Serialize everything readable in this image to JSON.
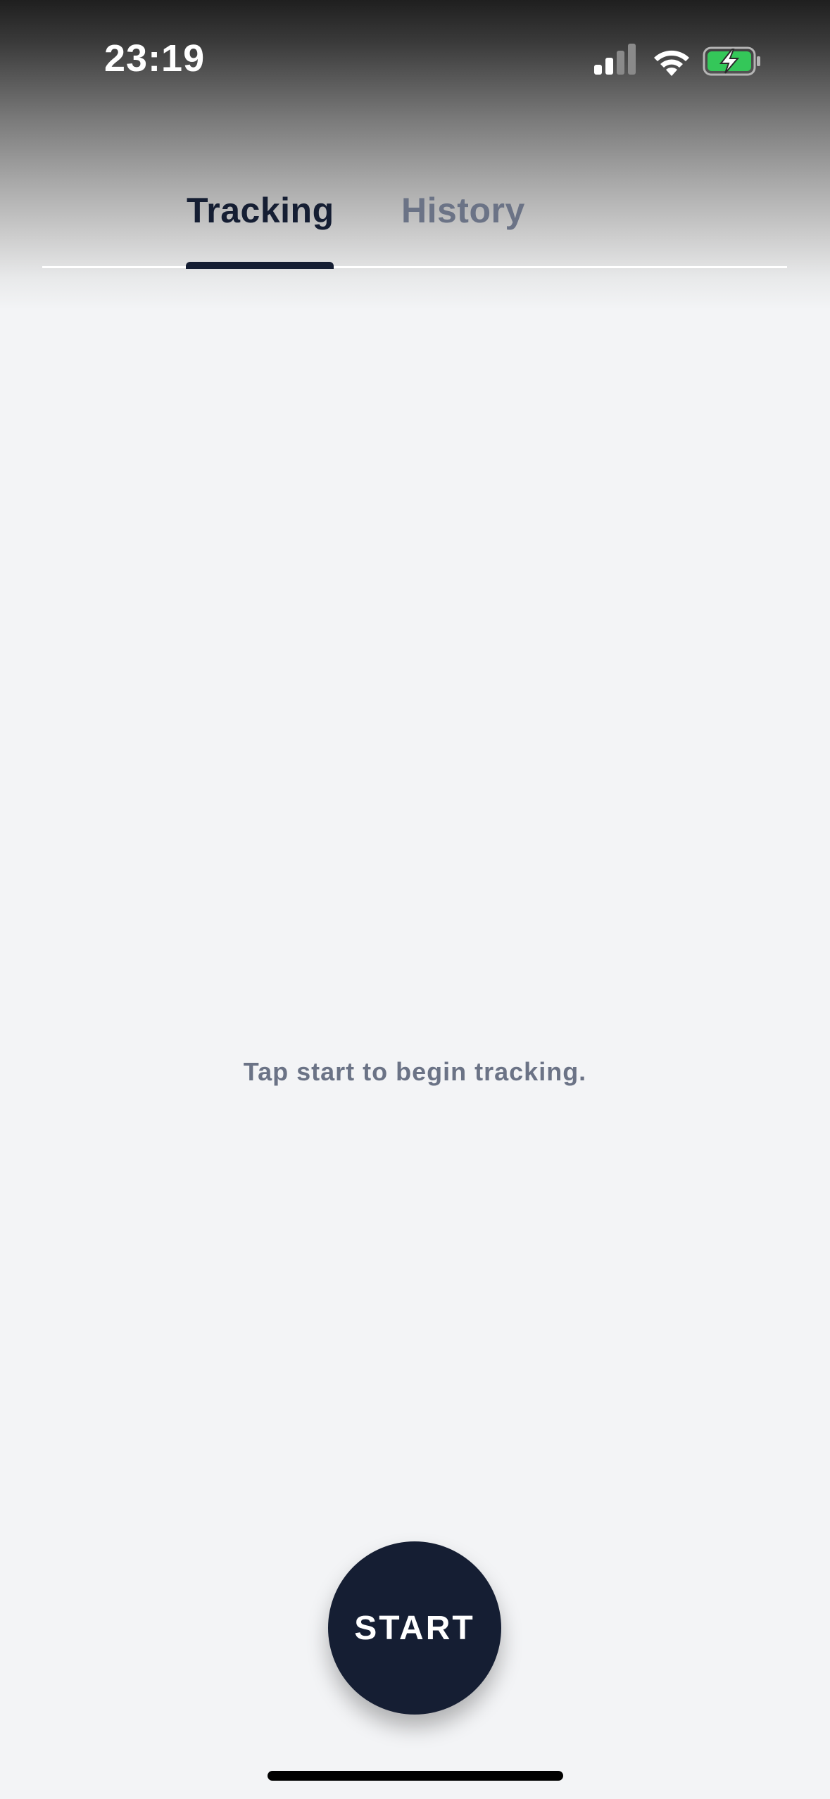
{
  "status_bar": {
    "time": "23:19",
    "icons": [
      "signal-icon",
      "wifi-icon",
      "battery-charging-icon"
    ],
    "battery_color": "#34c759"
  },
  "tabs": [
    {
      "label": "Tracking",
      "active": true
    },
    {
      "label": "History",
      "active": false
    }
  ],
  "main": {
    "empty_message": "Tap start to begin tracking."
  },
  "start_button": {
    "label": "START"
  },
  "colors": {
    "primary": "#151e33",
    "muted_text": "#6b7386",
    "background": "#f3f4f6"
  }
}
